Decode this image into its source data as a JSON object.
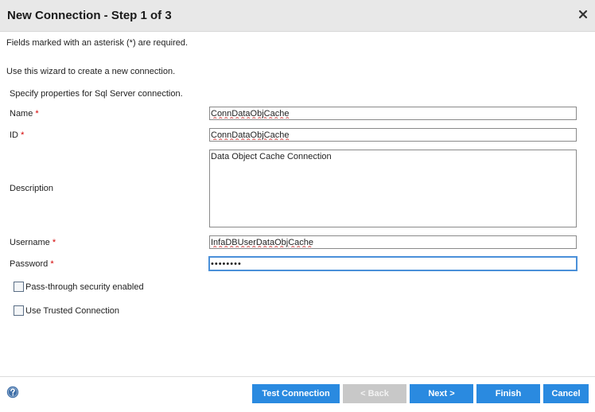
{
  "dialog": {
    "title": "New Connection - Step 1 of 3",
    "close_icon": "close-x-icon"
  },
  "intro": {
    "required_note": "Fields marked with an asterisk (*) are required.",
    "wizard_note": "Use this wizard to create a new connection.",
    "properties_heading": "Specify properties for Sql Server connection."
  },
  "form": {
    "name": {
      "label": "Name",
      "required": "*",
      "value": "ConnDataObjCache"
    },
    "id": {
      "label": "ID",
      "required": "*",
      "value": "ConnDataObjCache"
    },
    "description": {
      "label": "Description",
      "value": "Data Object Cache Connection"
    },
    "username": {
      "label": "Username",
      "required": "*",
      "value": "InfaDBUserDataObjCache"
    },
    "password": {
      "label": "Password",
      "required": "*",
      "value": "••••••••"
    },
    "pass_through": {
      "label": "Pass-through security enabled",
      "checked": false
    },
    "trusted": {
      "label": "Use Trusted Connection",
      "checked": false
    }
  },
  "footer": {
    "help_icon": "help-question-icon",
    "test_connection": "Test Connection",
    "back": "< Back",
    "next": "Next >",
    "finish": "Finish",
    "cancel": "Cancel"
  },
  "colors": {
    "primary_button": "#2a8ae0",
    "disabled_button": "#c8c8c8",
    "required_asterisk": "#d40000",
    "focus_border": "#4a90d9"
  }
}
